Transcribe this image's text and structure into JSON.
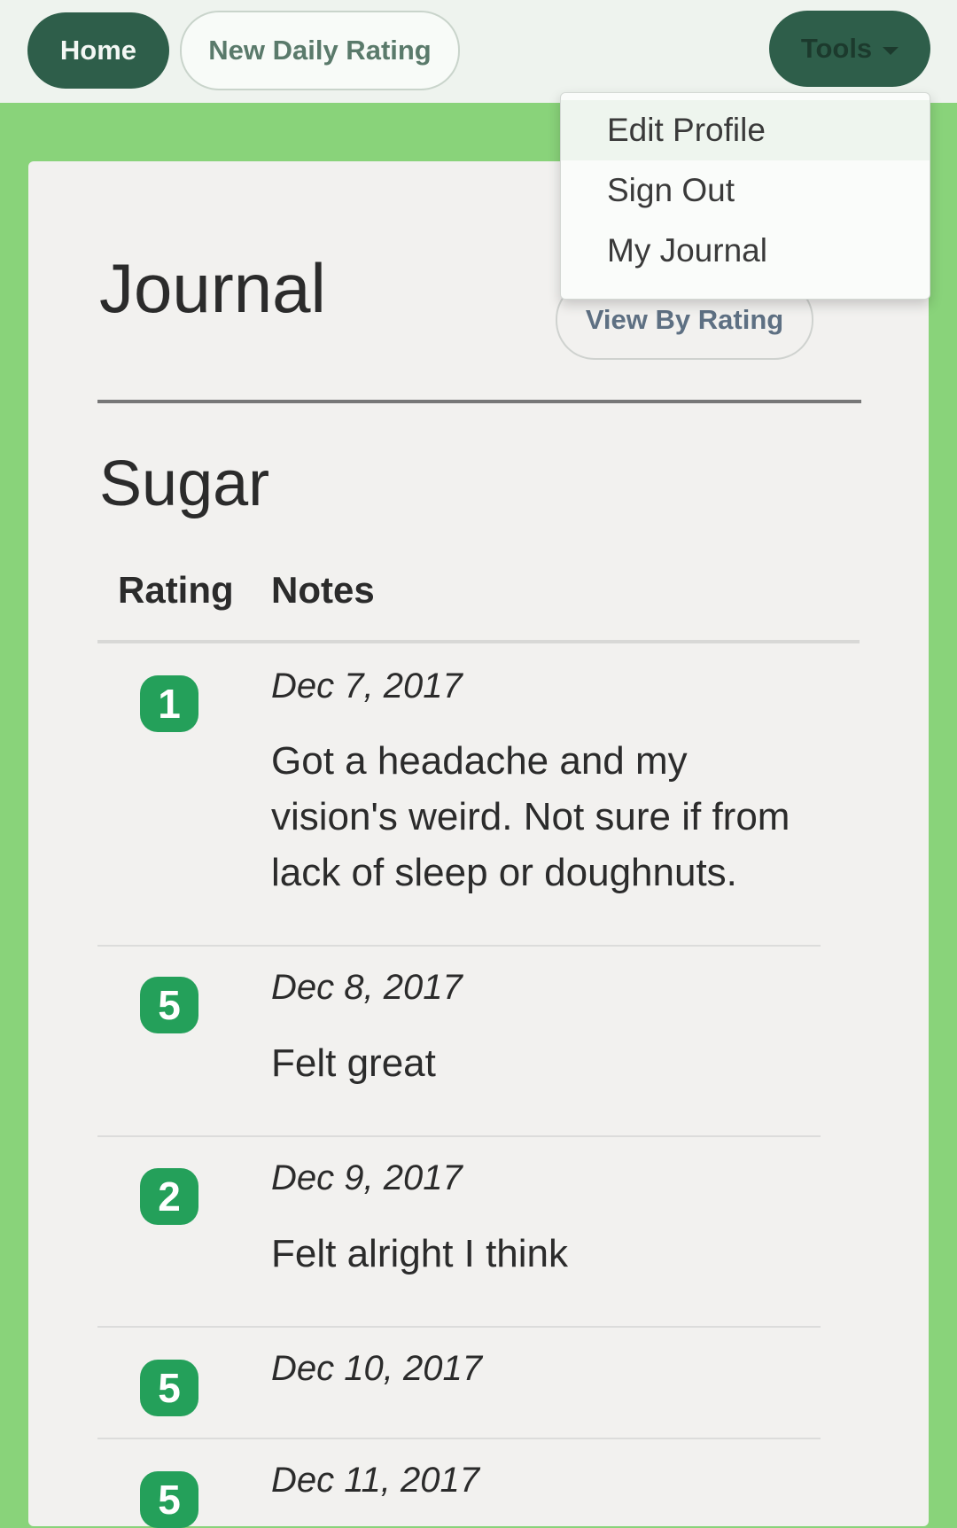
{
  "nav": {
    "home_label": "Home",
    "new_rating_label": "New Daily Rating",
    "tools_label": "Tools"
  },
  "tools_menu": {
    "items": [
      "Edit Profile",
      "Sign Out",
      "My Journal"
    ]
  },
  "page": {
    "title": "Journal",
    "view_by_rating_label": "View By Rating",
    "section_title": "Sugar"
  },
  "table": {
    "headers": {
      "rating": "Rating",
      "notes": "Notes"
    },
    "rows": [
      {
        "rating": "1",
        "date": "Dec 7, 2017",
        "note": "Got a headache and my vision's weird. Not sure if from lack of sleep or doughnuts."
      },
      {
        "rating": "5",
        "date": "Dec 8, 2017",
        "note": "Felt great"
      },
      {
        "rating": "2",
        "date": "Dec 9, 2017",
        "note": "Felt alright I think"
      },
      {
        "rating": "5",
        "date": "Dec 10, 2017",
        "note": ""
      },
      {
        "rating": "5",
        "date": "Dec 11, 2017",
        "note": ""
      }
    ]
  },
  "colors": {
    "page_background": "#89d37a",
    "primary_button": "#2e5e4a",
    "rating_badge": "#24a05a"
  }
}
